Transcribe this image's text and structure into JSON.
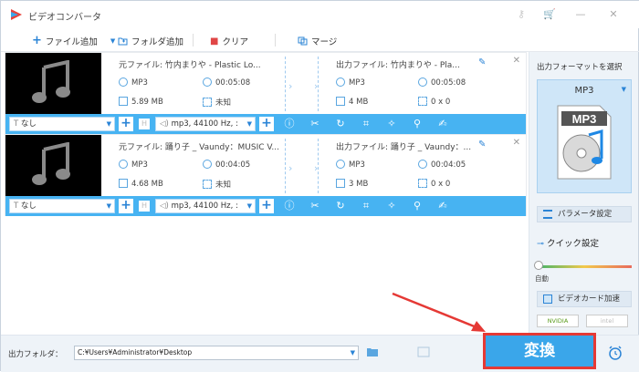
{
  "window": {
    "title": "ビデオコンバータ"
  },
  "toolbar": {
    "add_file": "ファイル追加",
    "add_folder": "フォルダ追加",
    "clear": "クリア",
    "merge": "マージ"
  },
  "items": [
    {
      "source_name": "元ファイル: 竹内まりや - Plastic Lo...",
      "source_format": "MP3",
      "source_duration": "00:05:08",
      "source_size": "5.89 MB",
      "source_resolution": "未知",
      "output_name": "出力ファイル: 竹内まりや - Pla...",
      "output_format": "MP3",
      "output_duration": "00:05:08",
      "output_size": "4 MB",
      "output_resolution": "0 x 0",
      "subtitle": "なし",
      "audio": "mp3, 44100 Hz, :"
    },
    {
      "source_name": "元ファイル: 踊り子 _ Vaundy：MUSIC V...",
      "source_format": "MP3",
      "source_duration": "00:04:05",
      "source_size": "4.68 MB",
      "source_resolution": "未知",
      "output_name": "出力ファイル: 踊り子 _ Vaundy：...",
      "output_format": "MP3",
      "output_duration": "00:04:05",
      "output_size": "3 MB",
      "output_resolution": "0 x 0",
      "subtitle": "なし",
      "audio": "mp3, 44100 Hz, :"
    }
  ],
  "right_panel": {
    "title": "出力フォーマットを選択",
    "format": "MP3",
    "format_icon_text": "MP3",
    "params": "パラメータ設定",
    "quick": "クイック設定",
    "auto": "自動",
    "gpu": "ビデオカード加速",
    "nvidia": "NVIDIA",
    "intel": "intel"
  },
  "bottom": {
    "output_label": "出力フォルダ：",
    "output_path": "C:¥Users¥Administrator¥Desktop",
    "convert": "変換"
  },
  "colors": {
    "accent": "#47b3f2",
    "button": "#3aa6ea",
    "highlight": "#e53935"
  }
}
